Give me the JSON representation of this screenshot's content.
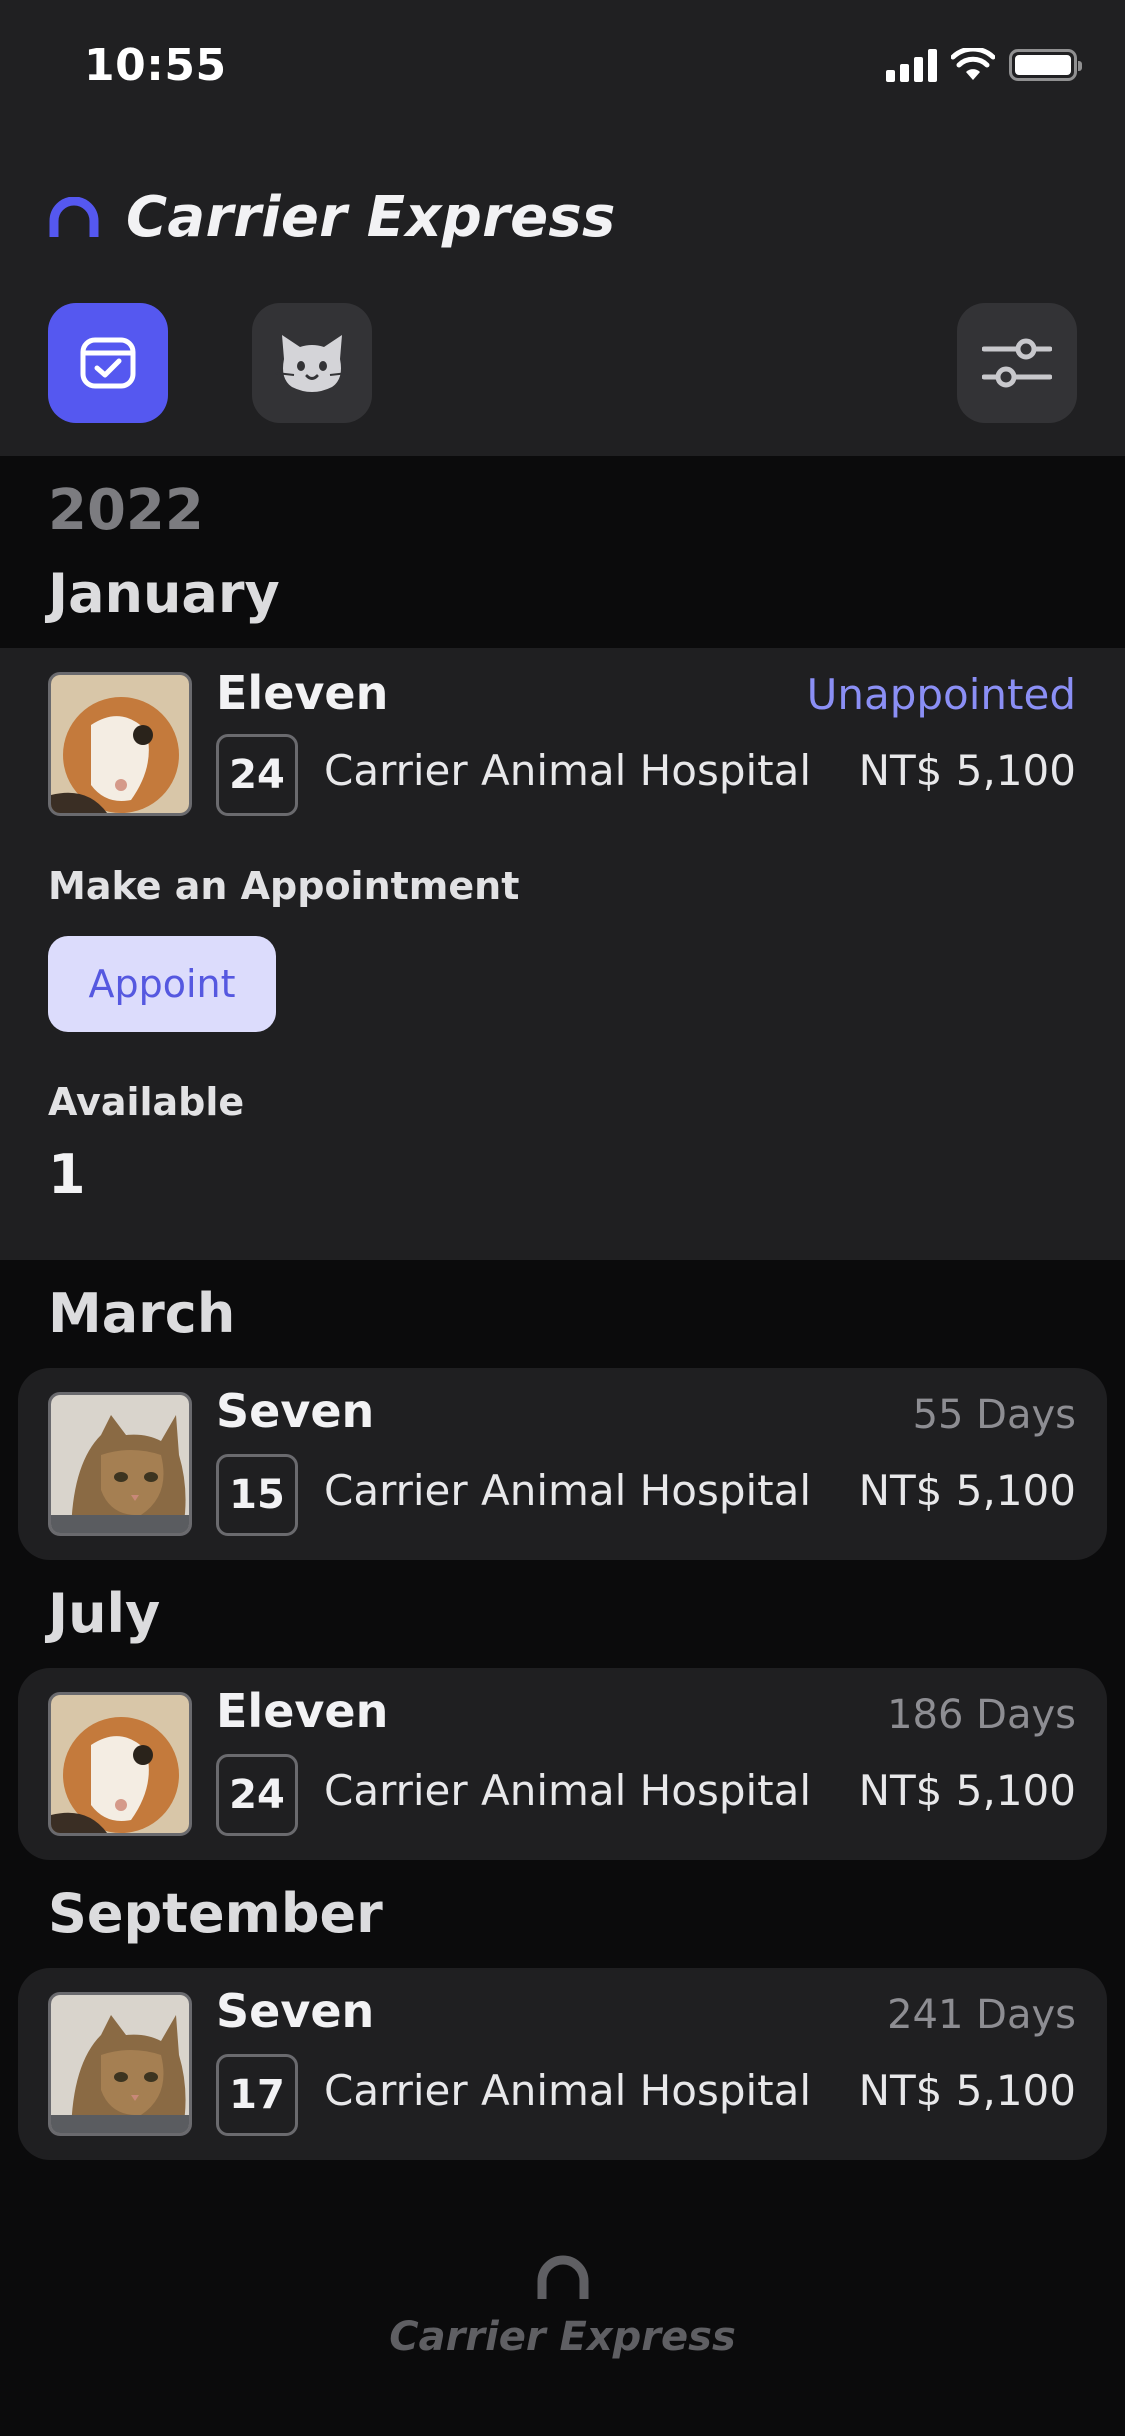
{
  "status_bar": {
    "time": "10:55"
  },
  "app": {
    "title": "Carrier Express",
    "accent": "#5558f0"
  },
  "toolbar": {
    "calendar_icon": "calendar-check-icon",
    "cat_icon": "cat-icon",
    "filter_icon": "sliders-icon"
  },
  "year": "2022",
  "expanded": {
    "month": "January",
    "pet": "Eleven",
    "day": "24",
    "hospital": "Carrier Animal Hospital",
    "status": "Unappointed",
    "price": "NT$ 5,100",
    "make_label": "Make an Appointment",
    "appoint_button": "Appoint",
    "available_label": "Available",
    "available_count": "1"
  },
  "cards": [
    {
      "month": "March",
      "pet": "Seven",
      "day": "15",
      "hospital": "Carrier Animal Hospital",
      "days": "55 Days",
      "price": "NT$ 5,100"
    },
    {
      "month": "July",
      "pet": "Eleven",
      "day": "24",
      "hospital": "Carrier Animal Hospital",
      "days": "186 Days",
      "price": "NT$ 5,100"
    },
    {
      "month": "September",
      "pet": "Seven",
      "day": "17",
      "hospital": "Carrier Animal Hospital",
      "days": "241 Days",
      "price": "NT$ 5,100"
    }
  ],
  "footer": {
    "title": "Carrier Express"
  }
}
